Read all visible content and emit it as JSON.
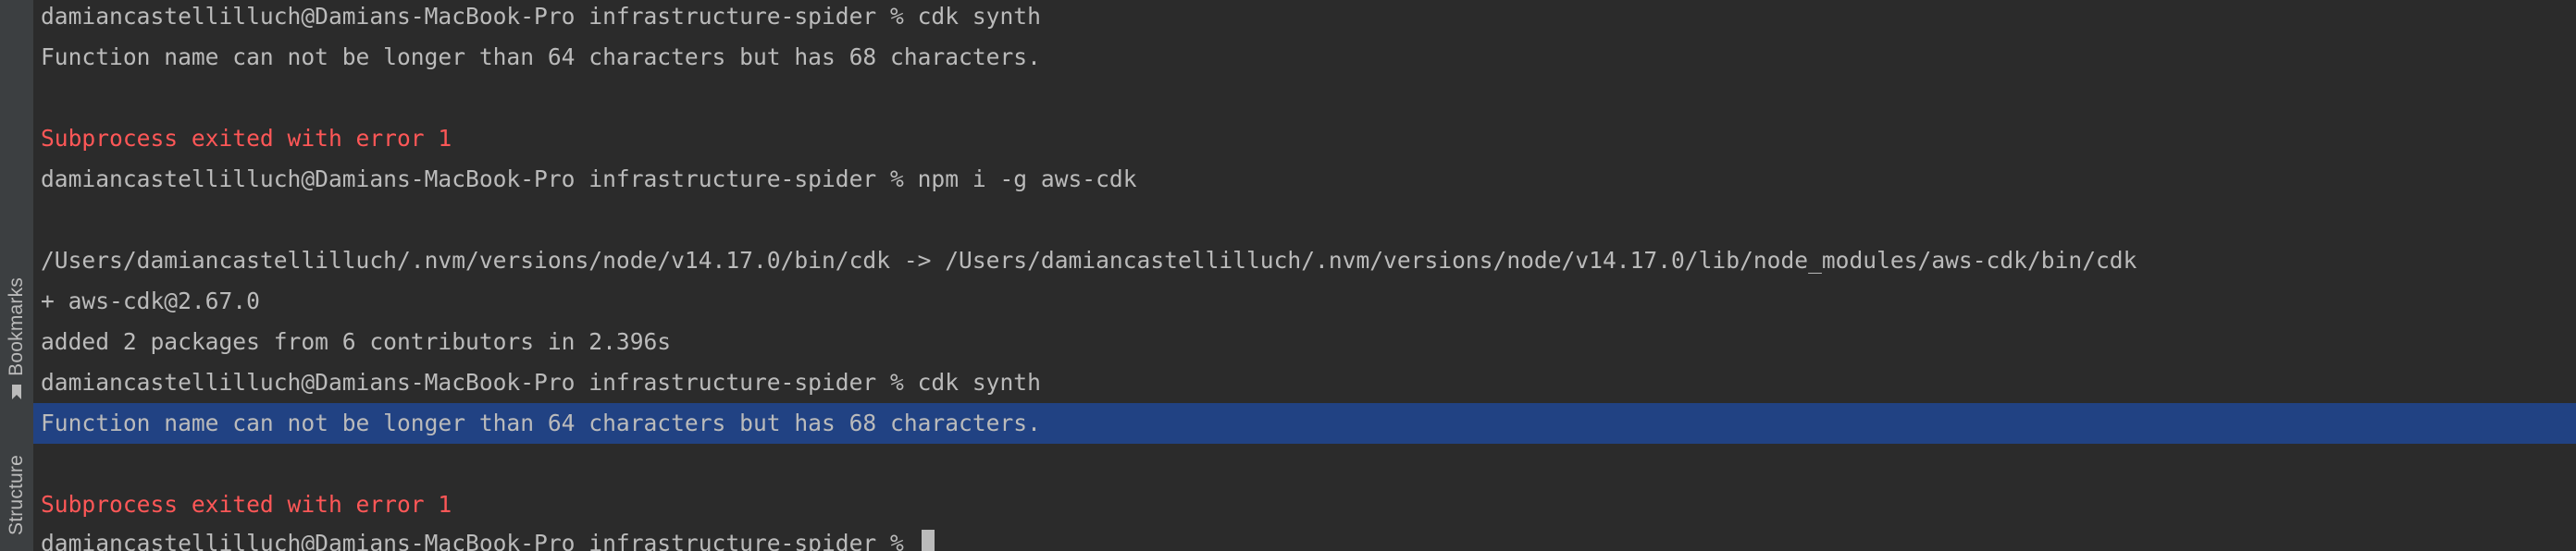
{
  "sidebar": {
    "bookmarks_label": "Bookmarks",
    "structure_label": "Structure"
  },
  "terminal": {
    "lines": [
      {
        "text": "damiancastellilluch@Damians-MacBook-Pro infrastructure-spider % cdk synth",
        "style": "normal"
      },
      {
        "text": "Function name can not be longer than 64 characters but has 68 characters.",
        "style": "normal"
      },
      {
        "text": "",
        "style": "normal"
      },
      {
        "text": "Subprocess exited with error 1",
        "style": "error"
      },
      {
        "text": "damiancastellilluch@Damians-MacBook-Pro infrastructure-spider % npm i -g aws-cdk",
        "style": "normal"
      },
      {
        "text": "",
        "style": "normal"
      },
      {
        "text": "/Users/damiancastellilluch/.nvm/versions/node/v14.17.0/bin/cdk -> /Users/damiancastellilluch/.nvm/versions/node/v14.17.0/lib/node_modules/aws-cdk/bin/cdk",
        "style": "normal"
      },
      {
        "text": "+ aws-cdk@2.67.0",
        "style": "normal"
      },
      {
        "text": "added 2 packages from 6 contributors in 2.396s",
        "style": "normal"
      },
      {
        "text": "damiancastellilluch@Damians-MacBook-Pro infrastructure-spider % cdk synth",
        "style": "normal"
      },
      {
        "text": "Function name can not be longer than 64 characters but has 68 characters.",
        "style": "selected"
      },
      {
        "text": "",
        "style": "normal"
      },
      {
        "text": "Subprocess exited with error 1",
        "style": "error"
      },
      {
        "text": "damiancastellilluch@Damians-MacBook-Pro infrastructure-spider % ",
        "style": "prompt"
      }
    ]
  },
  "colors": {
    "background": "#2b2b2b",
    "sidebar": "#3c3f41",
    "text": "#bbbbbb",
    "error": "#ff5757",
    "selection": "#214283"
  },
  "icons": {
    "bookmark": "bookmark-icon"
  }
}
